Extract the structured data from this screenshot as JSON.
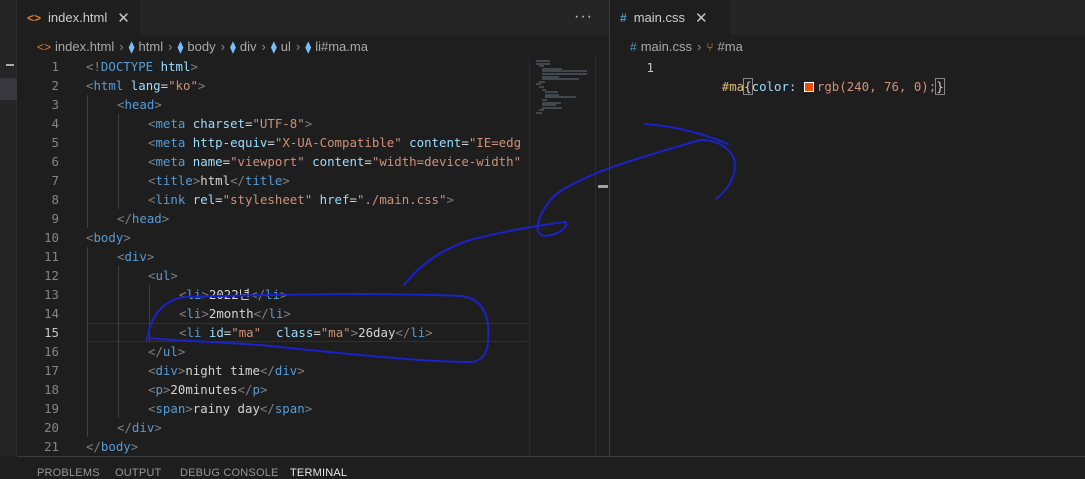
{
  "left_editor": {
    "tab": {
      "icon": "<>",
      "label": "index.html"
    },
    "more_label": "···",
    "breadcrumb": [
      {
        "icon": "<>",
        "label": "index.html"
      },
      {
        "icon": "⧫",
        "label": "html"
      },
      {
        "icon": "⧫",
        "label": "body"
      },
      {
        "icon": "⧫",
        "label": "div"
      },
      {
        "icon": "⧫",
        "label": "ul"
      },
      {
        "icon": "⧫",
        "label": "li#ma.ma"
      }
    ],
    "active_line": 15,
    "lines": [
      {
        "n": "1",
        "indent": 0,
        "tokens": [
          [
            "tg",
            "<!"
          ],
          [
            "tn",
            "DOCTYPE"
          ],
          [
            "pl",
            " "
          ],
          [
            "at",
            "html"
          ],
          [
            "tg",
            ">"
          ]
        ]
      },
      {
        "n": "2",
        "indent": 0,
        "tokens": [
          [
            "tg",
            "<"
          ],
          [
            "tn",
            "html"
          ],
          [
            "pl",
            " "
          ],
          [
            "at",
            "lang"
          ],
          [
            "pl",
            "="
          ],
          [
            "sv",
            "\"ko\""
          ],
          [
            "tg",
            ">"
          ]
        ]
      },
      {
        "n": "3",
        "indent": 1,
        "tokens": [
          [
            "tg",
            "<"
          ],
          [
            "tn",
            "head"
          ],
          [
            "tg",
            ">"
          ]
        ]
      },
      {
        "n": "4",
        "indent": 2,
        "tokens": [
          [
            "tg",
            "<"
          ],
          [
            "tn",
            "meta"
          ],
          [
            "pl",
            " "
          ],
          [
            "at",
            "charset"
          ],
          [
            "pl",
            "="
          ],
          [
            "sv",
            "\"UTF-8\""
          ],
          [
            "tg",
            ">"
          ]
        ]
      },
      {
        "n": "5",
        "indent": 2,
        "tokens": [
          [
            "tg",
            "<"
          ],
          [
            "tn",
            "meta"
          ],
          [
            "pl",
            " "
          ],
          [
            "at",
            "http-equiv"
          ],
          [
            "pl",
            "="
          ],
          [
            "sv",
            "\"X-UA-Compatible\""
          ],
          [
            "pl",
            " "
          ],
          [
            "at",
            "content"
          ],
          [
            "pl",
            "="
          ],
          [
            "sv",
            "\"IE=edg"
          ]
        ]
      },
      {
        "n": "6",
        "indent": 2,
        "tokens": [
          [
            "tg",
            "<"
          ],
          [
            "tn",
            "meta"
          ],
          [
            "pl",
            " "
          ],
          [
            "at",
            "name"
          ],
          [
            "pl",
            "="
          ],
          [
            "sv",
            "\"viewport\""
          ],
          [
            "pl",
            " "
          ],
          [
            "at",
            "content"
          ],
          [
            "pl",
            "="
          ],
          [
            "sv",
            "\"width=device-width\""
          ]
        ]
      },
      {
        "n": "7",
        "indent": 2,
        "tokens": [
          [
            "tg",
            "<"
          ],
          [
            "tn",
            "title"
          ],
          [
            "tg",
            ">"
          ],
          [
            "pl",
            "html"
          ],
          [
            "tg",
            "</"
          ],
          [
            "tn",
            "title"
          ],
          [
            "tg",
            ">"
          ]
        ]
      },
      {
        "n": "8",
        "indent": 2,
        "tokens": [
          [
            "tg",
            "<"
          ],
          [
            "tn",
            "link"
          ],
          [
            "pl",
            " "
          ],
          [
            "at",
            "rel"
          ],
          [
            "pl",
            "="
          ],
          [
            "sv",
            "\"stylesheet\""
          ],
          [
            "pl",
            " "
          ],
          [
            "at",
            "href"
          ],
          [
            "pl",
            "="
          ],
          [
            "sv",
            "\"./main.css\""
          ],
          [
            "tg",
            ">"
          ]
        ]
      },
      {
        "n": "9",
        "indent": 1,
        "tokens": [
          [
            "tg",
            "</"
          ],
          [
            "tn",
            "head"
          ],
          [
            "tg",
            ">"
          ]
        ]
      },
      {
        "n": "10",
        "indent": 0,
        "tokens": [
          [
            "tg",
            "<"
          ],
          [
            "tn",
            "body"
          ],
          [
            "tg",
            ">"
          ]
        ]
      },
      {
        "n": "11",
        "indent": 1,
        "tokens": [
          [
            "tg",
            "<"
          ],
          [
            "tn",
            "div"
          ],
          [
            "tg",
            ">"
          ]
        ]
      },
      {
        "n": "12",
        "indent": 2,
        "tokens": [
          [
            "tg",
            "<"
          ],
          [
            "tn",
            "ul"
          ],
          [
            "tg",
            ">"
          ]
        ]
      },
      {
        "n": "13",
        "indent": 3,
        "tokens": [
          [
            "tg",
            "<"
          ],
          [
            "tn",
            "li"
          ],
          [
            "tg",
            ">"
          ],
          [
            "pl",
            "2022년"
          ],
          [
            "tg",
            "</"
          ],
          [
            "tn",
            "li"
          ],
          [
            "tg",
            ">"
          ]
        ]
      },
      {
        "n": "14",
        "indent": 3,
        "tokens": [
          [
            "tg",
            "<"
          ],
          [
            "tn",
            "li"
          ],
          [
            "tg",
            ">"
          ],
          [
            "pl",
            "2month"
          ],
          [
            "tg",
            "</"
          ],
          [
            "tn",
            "li"
          ],
          [
            "tg",
            ">"
          ]
        ]
      },
      {
        "n": "15",
        "indent": 3,
        "tokens": [
          [
            "tg",
            "<"
          ],
          [
            "tn",
            "li"
          ],
          [
            "pl",
            " "
          ],
          [
            "at",
            "id"
          ],
          [
            "pl",
            "="
          ],
          [
            "sv",
            "\"ma\""
          ],
          [
            "pl",
            "  "
          ],
          [
            "at",
            "class"
          ],
          [
            "pl",
            "="
          ],
          [
            "sv",
            "\"ma\""
          ],
          [
            "tg",
            ">"
          ],
          [
            "pl",
            "26day"
          ],
          [
            "tg",
            "</"
          ],
          [
            "tn",
            "li"
          ],
          [
            "tg",
            ">"
          ]
        ]
      },
      {
        "n": "16",
        "indent": 2,
        "tokens": [
          [
            "tg",
            "</"
          ],
          [
            "tn",
            "ul"
          ],
          [
            "tg",
            ">"
          ]
        ]
      },
      {
        "n": "17",
        "indent": 2,
        "tokens": [
          [
            "tg",
            "<"
          ],
          [
            "tn",
            "div"
          ],
          [
            "tg",
            ">"
          ],
          [
            "pl",
            "night time"
          ],
          [
            "tg",
            "</"
          ],
          [
            "tn",
            "div"
          ],
          [
            "tg",
            ">"
          ]
        ]
      },
      {
        "n": "18",
        "indent": 2,
        "tokens": [
          [
            "tg",
            "<"
          ],
          [
            "tn",
            "p"
          ],
          [
            "tg",
            ">"
          ],
          [
            "pl",
            "20minutes"
          ],
          [
            "tg",
            "</"
          ],
          [
            "tn",
            "p"
          ],
          [
            "tg",
            ">"
          ]
        ]
      },
      {
        "n": "19",
        "indent": 2,
        "tokens": [
          [
            "tg",
            "<"
          ],
          [
            "tn",
            "span"
          ],
          [
            "tg",
            ">"
          ],
          [
            "pl",
            "rainy day"
          ],
          [
            "tg",
            "</"
          ],
          [
            "tn",
            "span"
          ],
          [
            "tg",
            ">"
          ]
        ]
      },
      {
        "n": "20",
        "indent": 1,
        "tokens": [
          [
            "tg",
            "</"
          ],
          [
            "tn",
            "div"
          ],
          [
            "tg",
            ">"
          ]
        ]
      },
      {
        "n": "21",
        "indent": 0,
        "tokens": [
          [
            "tg",
            "</"
          ],
          [
            "tn",
            "body"
          ],
          [
            "tg",
            ">"
          ]
        ]
      }
    ]
  },
  "right_editor": {
    "tab": {
      "icon": "#",
      "label": "main.css"
    },
    "breadcrumb": [
      {
        "icon": "#",
        "label": "main.css"
      },
      {
        "icon": "⑂",
        "label": "#ma"
      }
    ],
    "line_number": "1",
    "selector": "#ma",
    "brace_open": "{",
    "property": "color:",
    "value": "rgb(240, 76, 0);",
    "brace_close": "}",
    "swatch_color": "#f04c00"
  },
  "panel": {
    "tabs": [
      "PROBLEMS",
      "OUTPUT",
      "DEBUG CONSOLE",
      "TERMINAL"
    ],
    "active_tab": "TERMINAL"
  },
  "colors": {
    "background": "#1e1e1e",
    "tag_name": "#569cd6",
    "attribute": "#9cdcfe",
    "string": "#ce9178",
    "annotation_ink": "#1a22c8"
  }
}
